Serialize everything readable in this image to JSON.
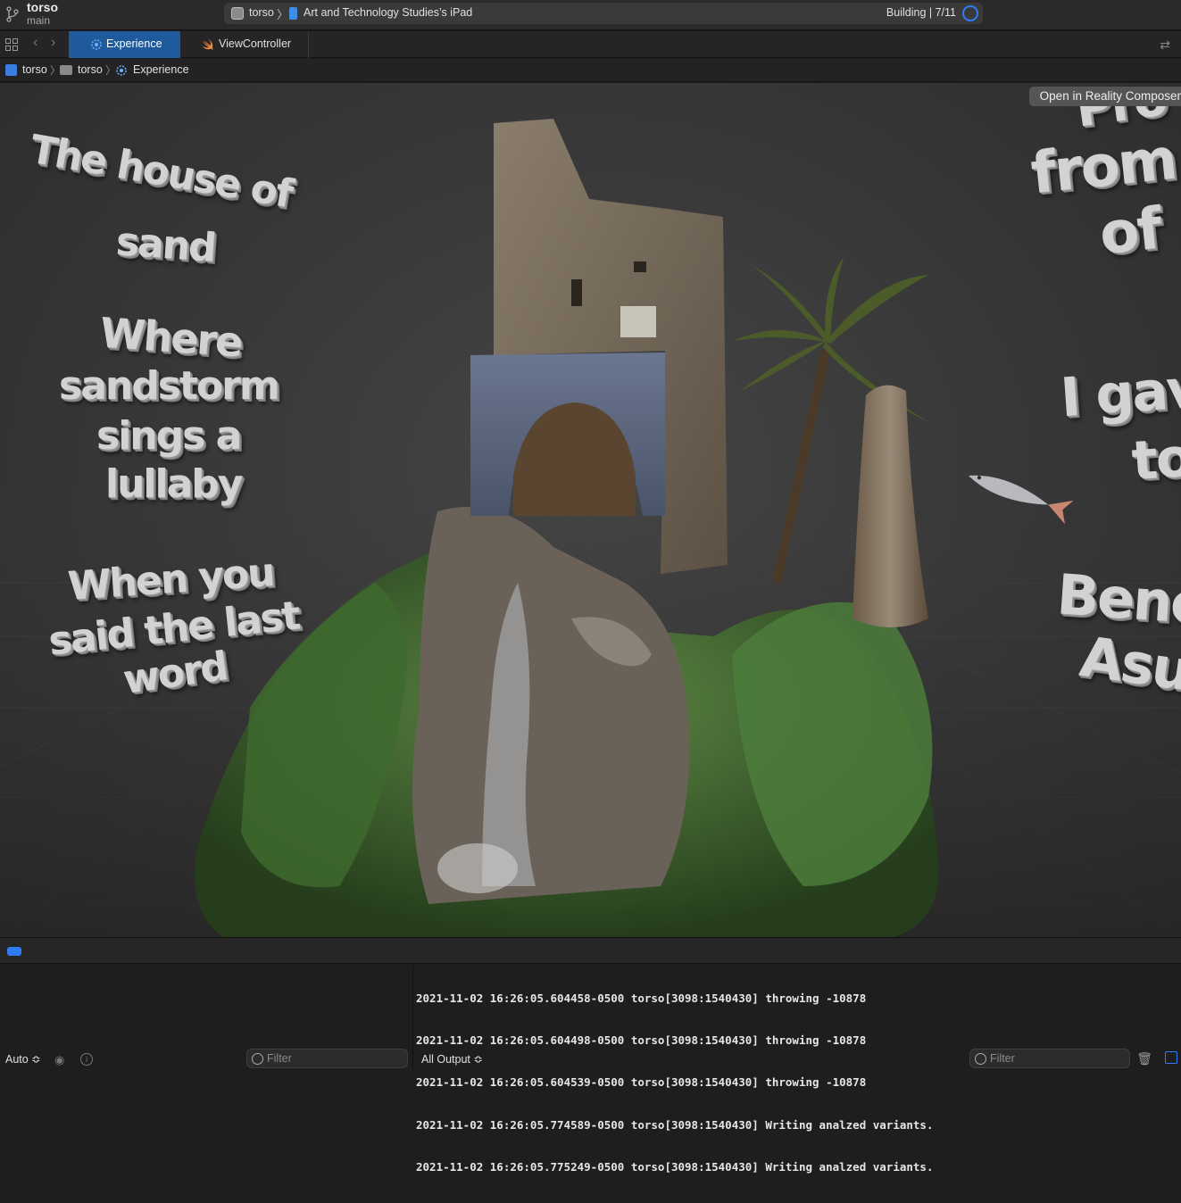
{
  "toolbar": {
    "project_name": "torso",
    "branch": "main",
    "scheme_target": "torso",
    "device": "Art and Technology Studies’s iPad",
    "build_status": "Building | 7/11"
  },
  "tabs": [
    {
      "label": "Experience",
      "icon": "reality-scene-icon",
      "active": true
    },
    {
      "label": "ViewController",
      "icon": "swift-icon",
      "active": false
    }
  ],
  "breadcrumb": [
    "torso",
    "torso",
    "Experience"
  ],
  "viewport": {
    "open_button": "Open in Reality Composer",
    "left_text": [
      [
        "The house of",
        "sand"
      ],
      [
        "Where",
        "sandstorm",
        "sings a",
        "lullaby"
      ],
      [
        "When you",
        "said the last",
        "word"
      ]
    ],
    "right_text": [
      "Pro",
      "from",
      "of",
      "I gav",
      "to",
      "Bene",
      "Asu"
    ]
  },
  "debug": {
    "variables_mode": "Auto ≎",
    "variables_filter_placeholder": "Filter",
    "output_mode": "All Output ≎",
    "console_filter_placeholder": "Filter",
    "console_lines": [
      "2021-11-02 16:26:05.604458-0500 torso[3098:1540430] throwing -10878",
      "2021-11-02 16:26:05.604498-0500 torso[3098:1540430] throwing -10878",
      "2021-11-02 16:26:05.604539-0500 torso[3098:1540430] throwing -10878",
      "2021-11-02 16:26:05.774589-0500 torso[3098:1540430] Writing analzed variants.",
      "2021-11-02 16:26:05.775249-0500 torso[3098:1540430] Writing analzed variants."
    ]
  },
  "colors": {
    "accent": "#2e7cf6",
    "active_tab": "#1f5a9c",
    "viewport_bg": "#393939"
  }
}
